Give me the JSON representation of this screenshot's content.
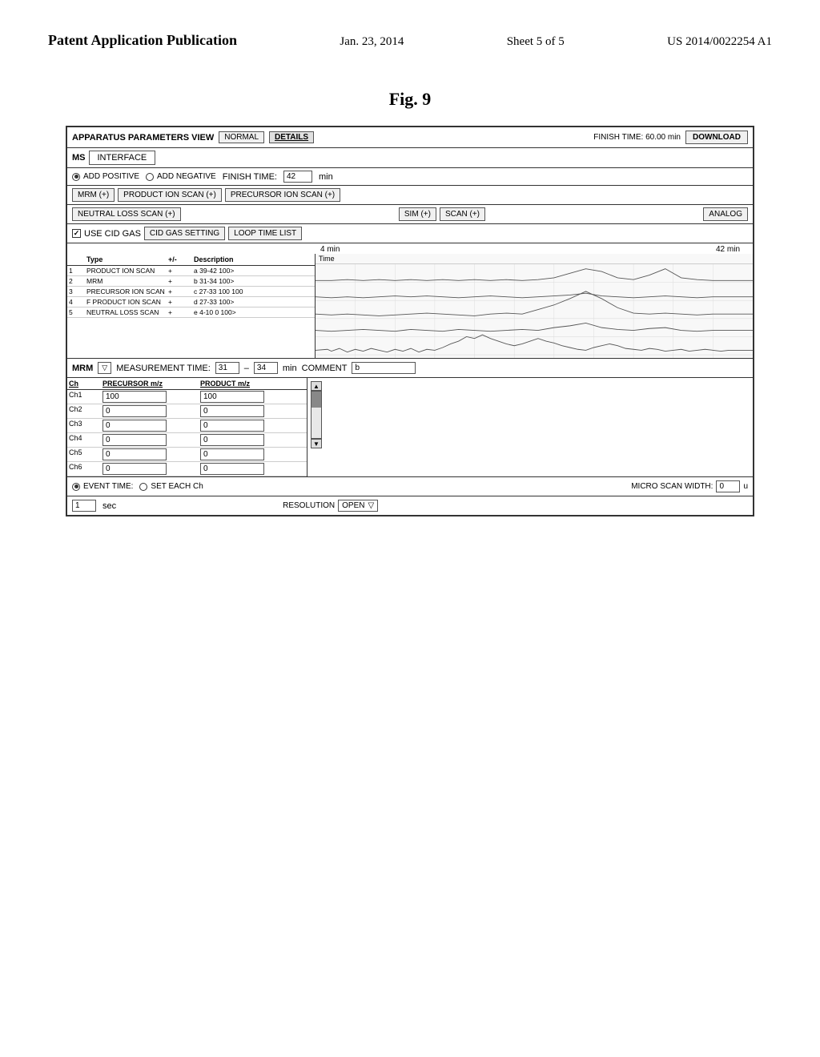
{
  "header": {
    "title": "Patent Application Publication",
    "date": "Jan. 23, 2014",
    "sheet": "Sheet 5 of 5",
    "patent": "US 2014/0022254 A1"
  },
  "figure": {
    "label": "Fig. 9"
  },
  "apparatus": {
    "title": "APPARATUS PARAMETERS VIEW",
    "tab_normal": "NORMAL",
    "tab_details": "DETAILS",
    "finish_time_label": "FINISH TIME: 60.00 min",
    "download_label": "DOWNLOAD",
    "ms_label": "MS",
    "interface_label": "INTERFACE",
    "add_positive": "ADD POSITIVE",
    "add_negative": "ADD NEGATIVE",
    "finish_time_42": "FINISH TIME:",
    "finish_time_value": "42",
    "finish_time_unit": "min",
    "mrm_btn": "MRM (+)",
    "product_ion_scan_btn": "PRODUCT ION SCAN (+)",
    "precursor_ion_scan_btn": "PRECURSOR ION SCAN (+)",
    "neutral_loss_scan_btn": "NEUTRAL LOSS SCAN (+)",
    "sim_btn": "SIM (+)",
    "scan_btn": "SCAN (+)",
    "analog_btn": "ANALOG",
    "use_cid_gas": "USE CID GAS",
    "cid_gas_setting": "CID GAS SETTING",
    "loop_time_list": "LOOP TIME LIST",
    "time_4": "4 min",
    "time_42": "42 min",
    "table_headers": {
      "number": "",
      "type": "Type",
      "plusminus": "+/-",
      "description": "Description",
      "time": "Time"
    },
    "table_rows": [
      {
        "num": "1",
        "type": "PRODUCT ION SCAN",
        "pm": "+",
        "desc": "a 39-42 100>"
      },
      {
        "num": "2",
        "type": "MRM",
        "pm": "+",
        "desc": "b 31-34 100>"
      },
      {
        "num": "3",
        "type": "PRECURSOR ION SCAN",
        "pm": "+",
        "desc": "c 27-33 100 100"
      },
      {
        "num": "4",
        "type": "F PRODUCT ION SCAN",
        "pm": "+",
        "desc": "d 27-33 100>"
      },
      {
        "num": "5",
        "type": "NEUTRAL LOSS SCAN",
        "pm": "+",
        "desc": "e 4-10 0  100>"
      }
    ],
    "mrm_label": "MRM",
    "measurement_time_label": "MEASUREMENT TIME:",
    "measurement_time_start": "31",
    "measurement_time_dash": "–",
    "measurement_time_end": "34",
    "measurement_time_unit": "min",
    "comment_label": "COMMENT",
    "comment_value": "b",
    "channel_headers": {
      "ch": "Ch",
      "precursor": "PRECURSOR m/z",
      "product": "PRODUCT m/z"
    },
    "channel_rows": [
      {
        "ch": "Ch1",
        "precursor": "100",
        "product": "100"
      },
      {
        "ch": "Ch2",
        "precursor": "0",
        "product": "0"
      },
      {
        "ch": "Ch3",
        "precursor": "0",
        "product": "0"
      },
      {
        "ch": "Ch4",
        "precursor": "0",
        "product": "0"
      },
      {
        "ch": "Ch5",
        "precursor": "0",
        "product": "0"
      },
      {
        "ch": "Ch6",
        "precursor": "0",
        "product": "0"
      }
    ],
    "event_time_label": "EVENT TIME:",
    "set_each_ch_label": "SET EACH Ch",
    "micro_scan_label": "MICRO SCAN WIDTH:",
    "micro_scan_value": "0",
    "micro_scan_unit": "u",
    "sec_value": "1",
    "sec_label": "sec",
    "resolution_label": "RESOLUTION",
    "resolution_value": "OPEN"
  }
}
